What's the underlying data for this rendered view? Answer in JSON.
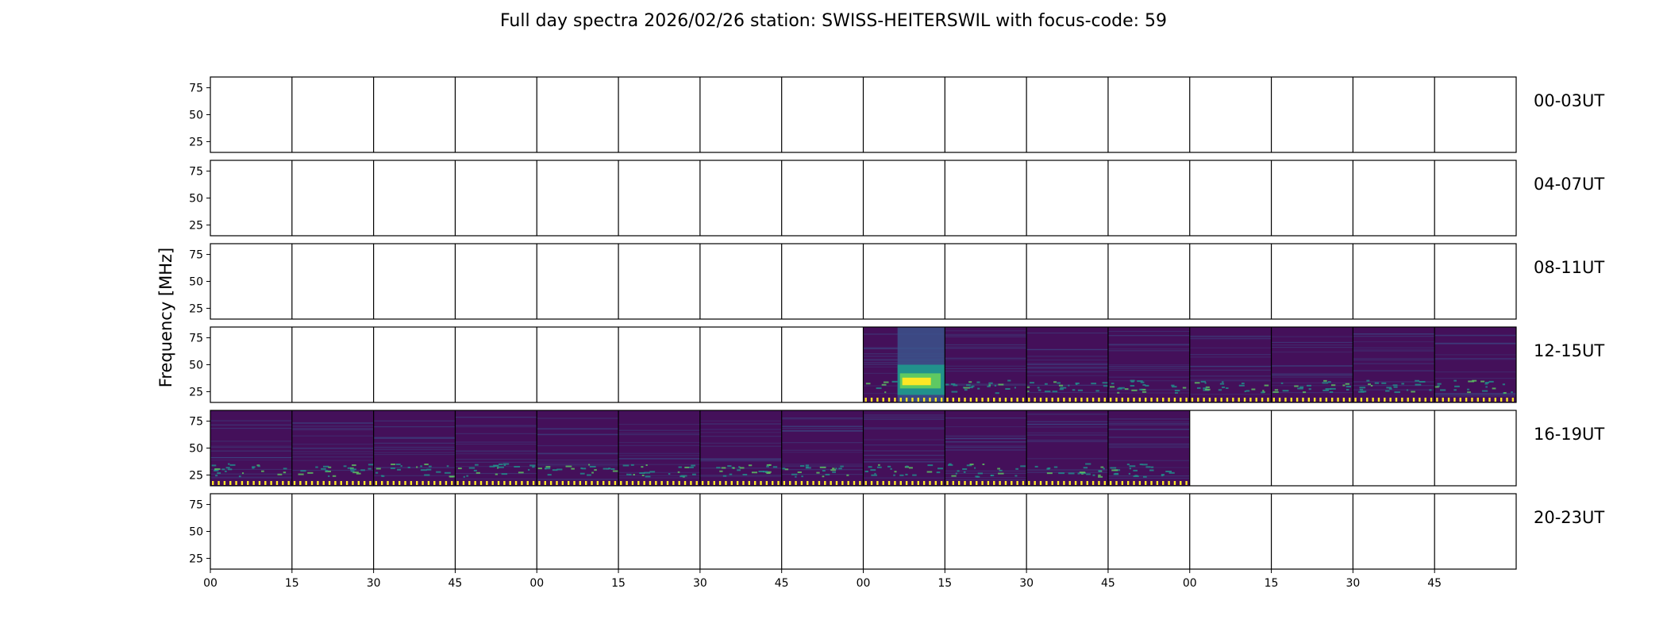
{
  "chart_data": {
    "type": "heatmap",
    "title": "Full day spectra 2026/02/26 station: SWISS-HEITERSWIL with focus-code: 59",
    "ylabel": "Frequency [MHz]",
    "yticks": [
      "75",
      "50",
      "25"
    ],
    "ylim": [
      15,
      85
    ],
    "xticks": [
      "00",
      "15",
      "30",
      "45",
      "00",
      "15",
      "30",
      "45",
      "00",
      "15",
      "30",
      "45",
      "00",
      "15",
      "30",
      "45"
    ],
    "panels_per_row": 16,
    "panel_minutes": 15,
    "rows": [
      {
        "label": "00-03UT",
        "filled_panels": []
      },
      {
        "label": "04-07UT",
        "filled_panels": []
      },
      {
        "label": "08-11UT",
        "filled_panels": []
      },
      {
        "label": "12-15UT",
        "filled_panels": [
          8,
          9,
          10,
          11,
          12,
          13,
          14,
          15
        ],
        "partial_start_minutes": 0,
        "burst_panel": 8
      },
      {
        "label": "16-19UT",
        "filled_panels": [
          0,
          1,
          2,
          3,
          4,
          5,
          6,
          7,
          8,
          9,
          10,
          11
        ]
      },
      {
        "label": "20-23UT",
        "filled_panels": []
      }
    ],
    "colormap": {
      "background": "#44105a",
      "mid": "#3b528b",
      "teal": "#21918c",
      "high": "#5ec962",
      "peak": "#fde725"
    }
  }
}
